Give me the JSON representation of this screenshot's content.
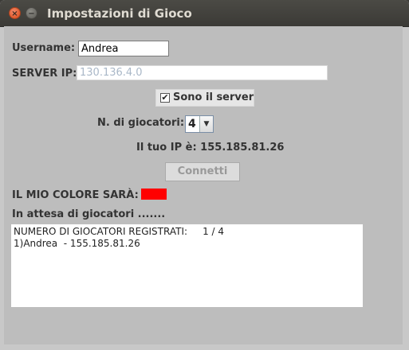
{
  "window": {
    "title": "Impostazioni di Gioco",
    "close_glyph": "×",
    "minimize_glyph": "−"
  },
  "form": {
    "username_label": "Username:",
    "username_value": "Andrea",
    "server_ip_label": "SERVER IP:",
    "server_ip_value": "130.136.4.0",
    "server_checkbox_label": "Sono il server",
    "server_checkbox_checked": true,
    "check_glyph": "✔",
    "players_label": "N. di giocatori:",
    "players_value": "4",
    "my_ip_text": "Il tuo IP è: 155.185.81.26",
    "connect_button": "Connetti",
    "color_label": "IL MIO COLORE SARÀ:",
    "color_value": "#ff0000",
    "waiting_text": "In attesa di giocatori .......",
    "log_lines": [
      "NUMERO DI GIOCATORI REGISTRATI:     1 / 4",
      "1)Andrea  - 155.185.81.26"
    ]
  }
}
